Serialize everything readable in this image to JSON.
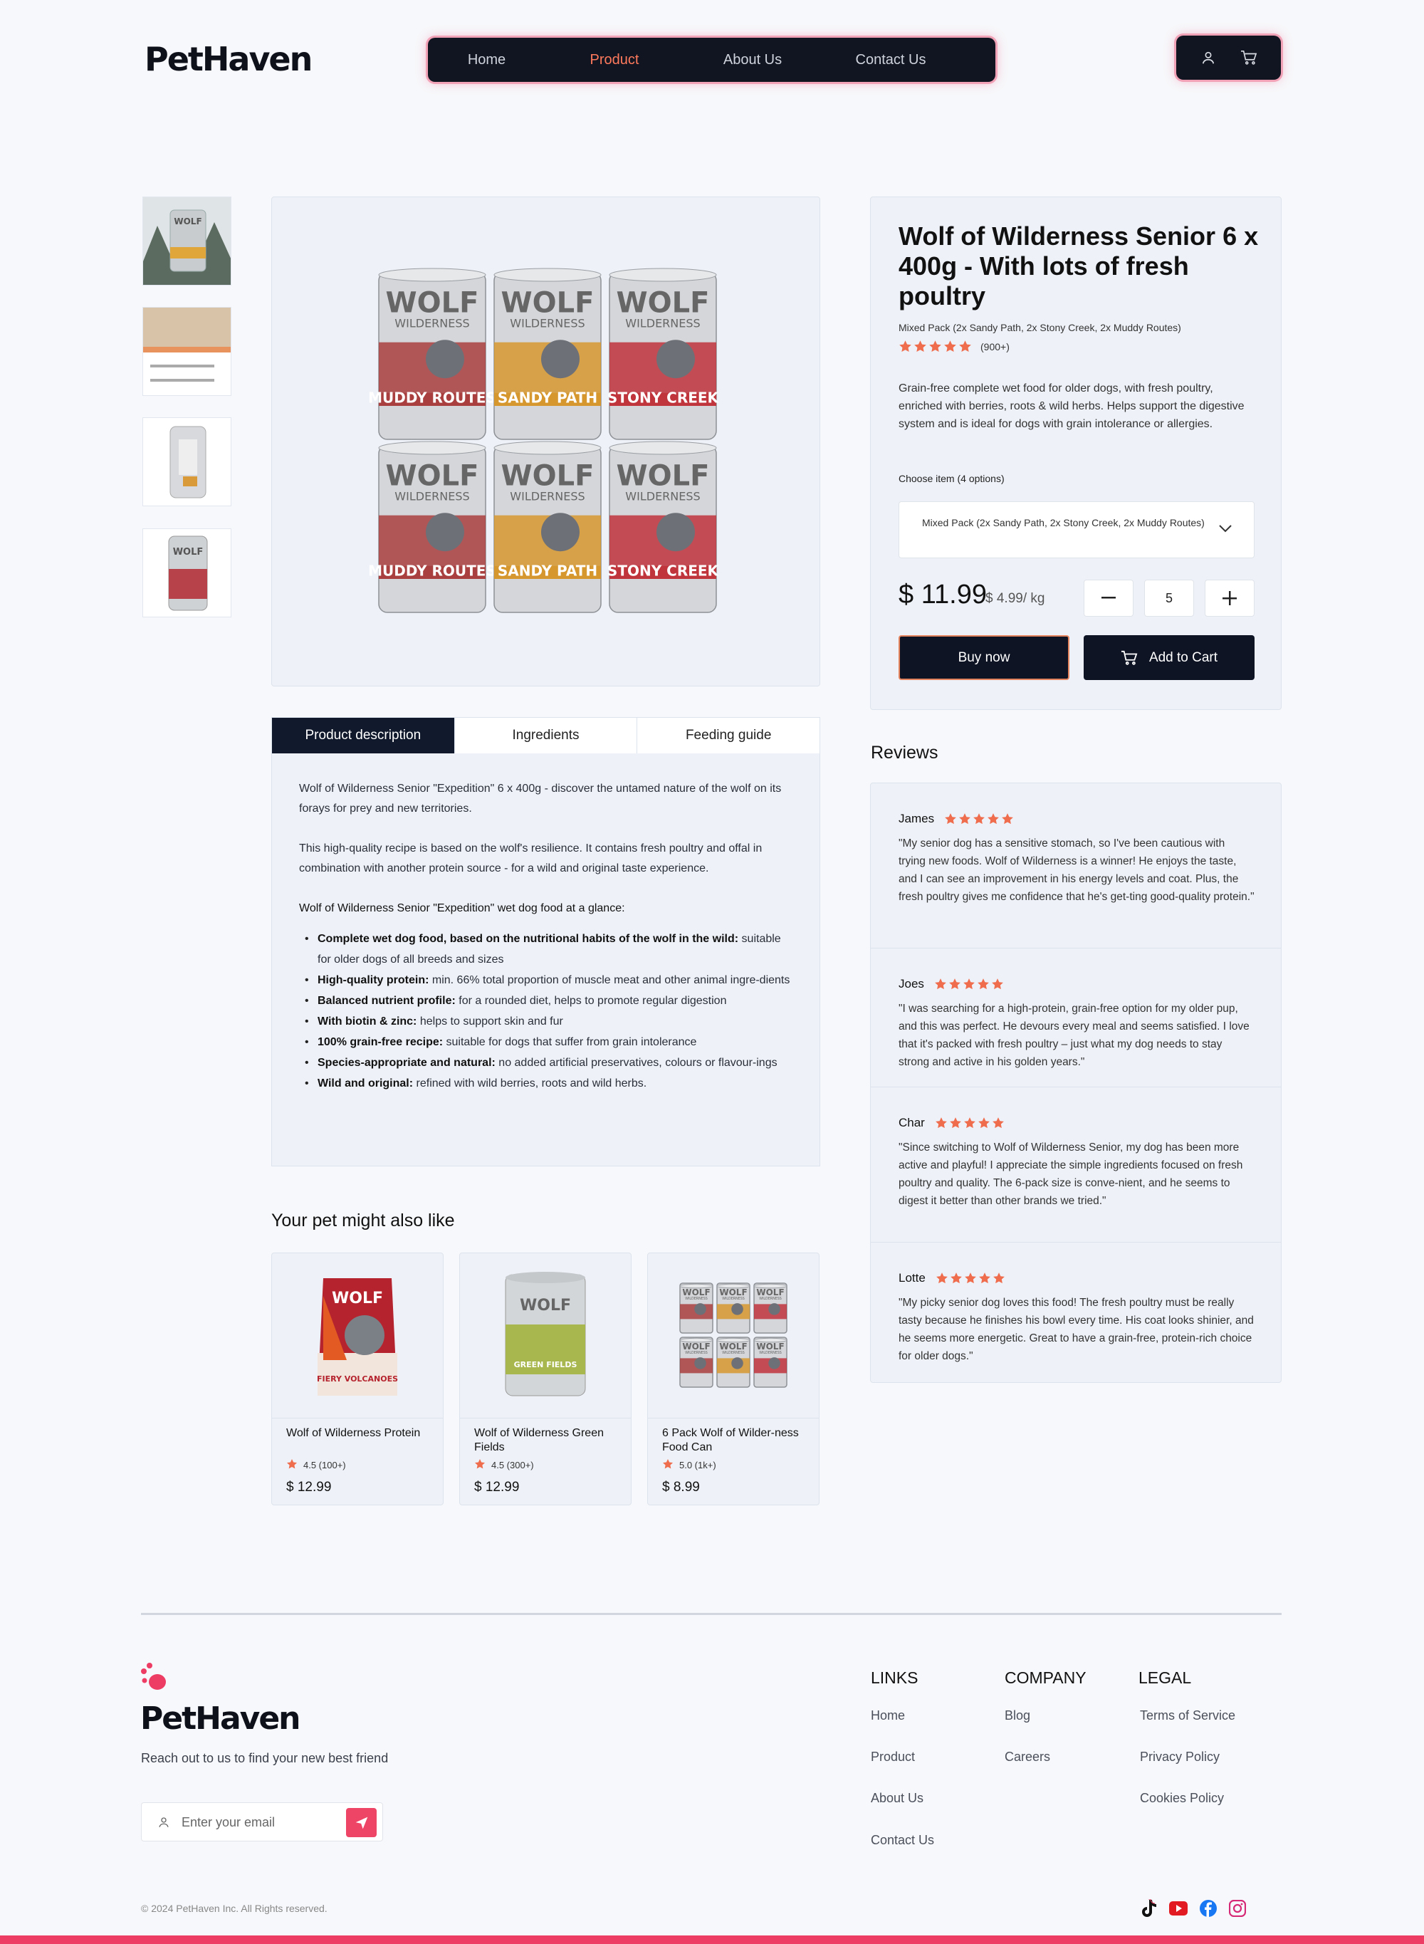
{
  "brand": {
    "name": "PetHaven"
  },
  "nav": {
    "home": "Home",
    "product": "Product",
    "about": "About Us",
    "contact": "Contact Us"
  },
  "header_icons": [
    "user-icon",
    "cart-icon"
  ],
  "colors": {
    "accent": "#ee3d64",
    "star": "#ef6c4d",
    "dark": "#111522",
    "nav_active": "#ff7a5c"
  },
  "product": {
    "title": "Wolf of Wilderness Senior 6 x 400g - With lots of fresh poultry",
    "variant": "Mixed Pack (2x Sandy Path, 2x Stony Creek, 2x Muddy Routes)",
    "rating": 5,
    "rating_count": "(900+)",
    "description": "Grain-free complete wet food for older dogs, with fresh poultry, enriched with berries, roots & wild herbs. Helps support the digestive system and is ideal for dogs with grain intolerance or allergies.",
    "choose_label": "Choose item (4 options)",
    "selected_option": "Mixed Pack (2x Sandy Path, 2x Stony Creek, 2x Muddy Routes)",
    "price": "$ 11.99",
    "unit_price": "$ 4.99/ kg",
    "quantity": "5",
    "buy_now": "Buy now",
    "add_to_cart": "Add to Cart",
    "can_labels": [
      "MUDDY ROUTES",
      "SANDY PATH",
      "STONY CREEK",
      "MUDDY ROUTES",
      "SANDY PATH",
      "STONY CREEK"
    ],
    "can_brand_top": "WOLF",
    "can_brand_bottom": "WILDERNESS"
  },
  "tabs": [
    "Product description",
    "Ingredients",
    "Feeding guide"
  ],
  "description": {
    "p1": "Wolf of Wilderness Senior \"Expedition\" 6 x 400g - discover the untamed nature of the wolf on its forays for prey and new territories.",
    "p2": "This high-quality recipe is based on the wolf's resilience. It contains fresh poultry and offal in combination with another protein source - for a wild and original taste experience.",
    "glance": "Wolf of Wilderness Senior \"Expedition\" wet dog food at a glance:",
    "bullets": [
      {
        "bold": "Complete wet dog food, based on the nutritional habits of the wolf in the wild:",
        "text": " suitable for older dogs of all breeds and sizes"
      },
      {
        "bold": "High-quality protein:",
        "text": " min. 66% total proportion of muscle meat and other animal ingre-dients"
      },
      {
        "bold": "Balanced nutrient profile:",
        "text": " for a rounded diet, helps to promote regular digestion"
      },
      {
        "bold": "With biotin & zinc:",
        "text": " helps to support skin and fur"
      },
      {
        "bold": "100% grain-free recipe:",
        "text": " suitable for dogs that suffer from grain intolerance"
      },
      {
        "bold": "Species-appropriate and natural:",
        "text": " no added artificial preservatives, colours or flavour-ings"
      },
      {
        "bold": "Wild and original:",
        "text": " refined with wild berries, roots and wild herbs."
      }
    ]
  },
  "also_like": {
    "title": "Your pet might also like",
    "items": [
      {
        "name": "Wolf of Wilderness Protein",
        "rating": "4.5 (100+)",
        "price": "$ 12.99",
        "img_label": "FIERY VOLCANOES"
      },
      {
        "name": "Wolf of Wilderness Green Fields",
        "rating": "4.5 (300+)",
        "price": "$ 12.99",
        "img_label": "GREEN FIELDS"
      },
      {
        "name": "6 Pack Wolf of Wilder-ness Food Can",
        "rating": "5.0 (1k+)",
        "price": "$ 8.99",
        "img_label": ""
      }
    ]
  },
  "reviews": {
    "title": "Reviews",
    "items": [
      {
        "name": "James",
        "rating": 5,
        "text": "\"My senior dog has a sensitive stomach, so I've been cautious with trying new foods. Wolf of Wilderness is a winner! He enjoys the taste, and I can see an improvement in his energy levels and coat. Plus, the fresh poultry gives me confidence that he's get-ting good-quality protein.\""
      },
      {
        "name": "Joes",
        "rating": 5,
        "text": "\"I was searching for a high-protein, grain-free option for my older pup, and this was perfect. He devours every meal and seems satisfied. I love that it's packed with fresh poultry – just what my dog needs to stay strong and active in his golden years.\""
      },
      {
        "name": "Char",
        "rating": 5,
        "text": "\"Since switching to Wolf of Wilderness Senior, my dog has been more active and playful! I appreciate the simple ingredients focused on fresh poultry and quality. The 6-pack size is conve-nient, and he seems to digest it better than other brands we tried.\""
      },
      {
        "name": "Lotte",
        "rating": 5,
        "text": "\"My picky senior dog loves this food! The fresh poultry must be really tasty because he finishes his bowl every time. His coat looks shinier, and he seems more energetic. Great to have a grain-free, protein-rich choice for older dogs.\""
      }
    ]
  },
  "footer": {
    "tagline": "Reach out to us to find your new best friend",
    "email_placeholder": "Enter your email",
    "links_title": "LINKS",
    "links": [
      "Home",
      "Product",
      "About Us",
      "Contact Us"
    ],
    "company_title": "COMPANY",
    "company": [
      "Blog",
      "Careers"
    ],
    "legal_title": "LEGAL",
    "legal": [
      "Terms of Service",
      "Privacy Policy",
      "Cookies Policy"
    ],
    "copyright": "© 2024 PetHaven Inc. All Rights reserved.",
    "socials": [
      "tiktok-icon",
      "youtube-icon",
      "facebook-icon",
      "instagram-icon"
    ]
  }
}
